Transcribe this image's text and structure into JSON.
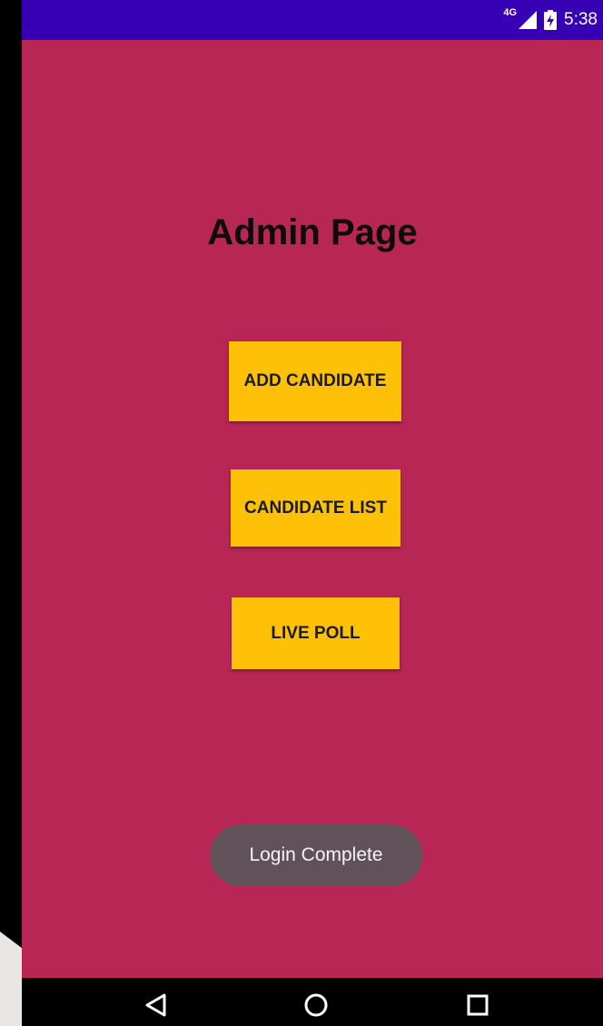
{
  "status_bar": {
    "network": "4G",
    "time": "5:38"
  },
  "page": {
    "title": "Admin Page"
  },
  "buttons": {
    "add_candidate": "ADD CANDIDATE",
    "candidate_list": "CANDIDATE LIST",
    "live_poll": "LIVE POLL"
  },
  "toast": {
    "message": "Login Complete"
  },
  "colors": {
    "status_bar": "#3700b3",
    "background": "#b72654",
    "button": "#ffc107",
    "toast": "#61525a"
  },
  "icons": {
    "signal": "cell-signal-icon",
    "battery": "battery-charging-icon",
    "back": "back-triangle-icon",
    "home": "home-circle-icon",
    "recents": "recents-square-icon"
  }
}
